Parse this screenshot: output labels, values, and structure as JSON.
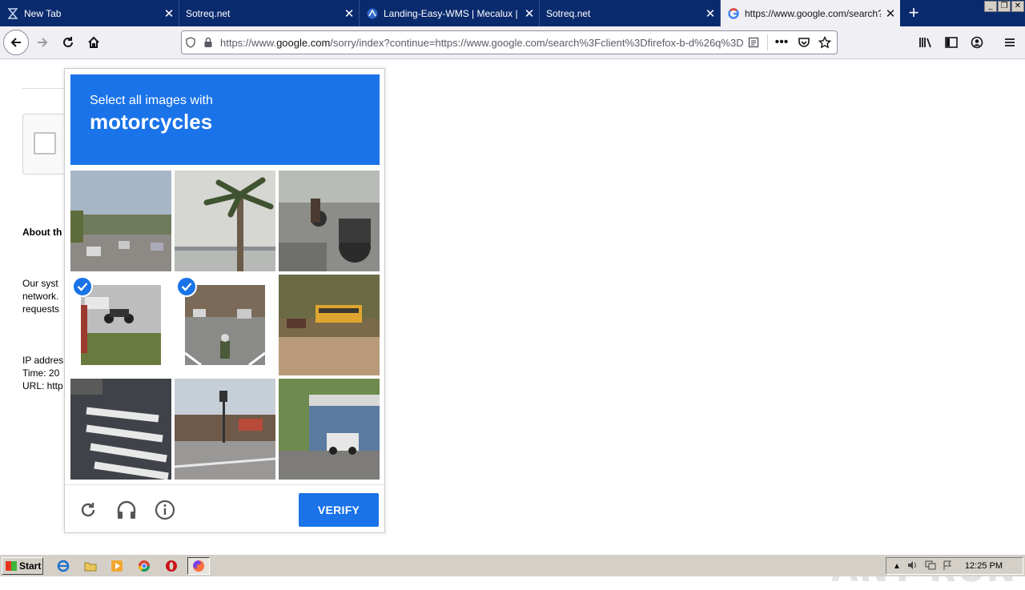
{
  "browser": {
    "tabs": [
      {
        "title": "New Tab",
        "favicon": "hourglass-icon",
        "active": false
      },
      {
        "title": "Sotreq.net",
        "favicon": "",
        "active": false
      },
      {
        "title": "Landing-Easy-WMS | Mecalux | ww",
        "favicon": "mecalux-icon",
        "active": false
      },
      {
        "title": "Sotreq.net",
        "favicon": "",
        "active": false
      },
      {
        "title": "https://www.google.com/search?c",
        "favicon": "google-icon",
        "active": true
      }
    ],
    "url_prefix": "https://www.",
    "url_host": "google.com",
    "url_rest": "/sorry/index?continue=https://www.google.com/search%3Fclient%3Dfirefox-b-d%26q%3D"
  },
  "page": {
    "about_heading": "About th",
    "about_body": "Our syst\nnetwork.\nrequests",
    "meta_lines": "IP addres\nTime: 20\nURL: http"
  },
  "captcha": {
    "prompt_line1": "Select all images with",
    "prompt_line2": "motorcycles",
    "verify_label": "VERIFY",
    "accent_color": "#1a73e8",
    "tiles": [
      {
        "label": "street-scene",
        "selected": false
      },
      {
        "label": "palm-tree-bridge",
        "selected": false
      },
      {
        "label": "motorcycles-parked",
        "selected": false
      },
      {
        "label": "motorcycle-on-street",
        "selected": true
      },
      {
        "label": "motorcycle-traffic",
        "selected": true
      },
      {
        "label": "school-bus",
        "selected": false
      },
      {
        "label": "crosswalk",
        "selected": false
      },
      {
        "label": "intersection",
        "selected": false
      },
      {
        "label": "house-car",
        "selected": false
      }
    ]
  },
  "watermark": "ANY RUN",
  "taskbar": {
    "start_label": "Start",
    "clock": "12:25 PM"
  }
}
